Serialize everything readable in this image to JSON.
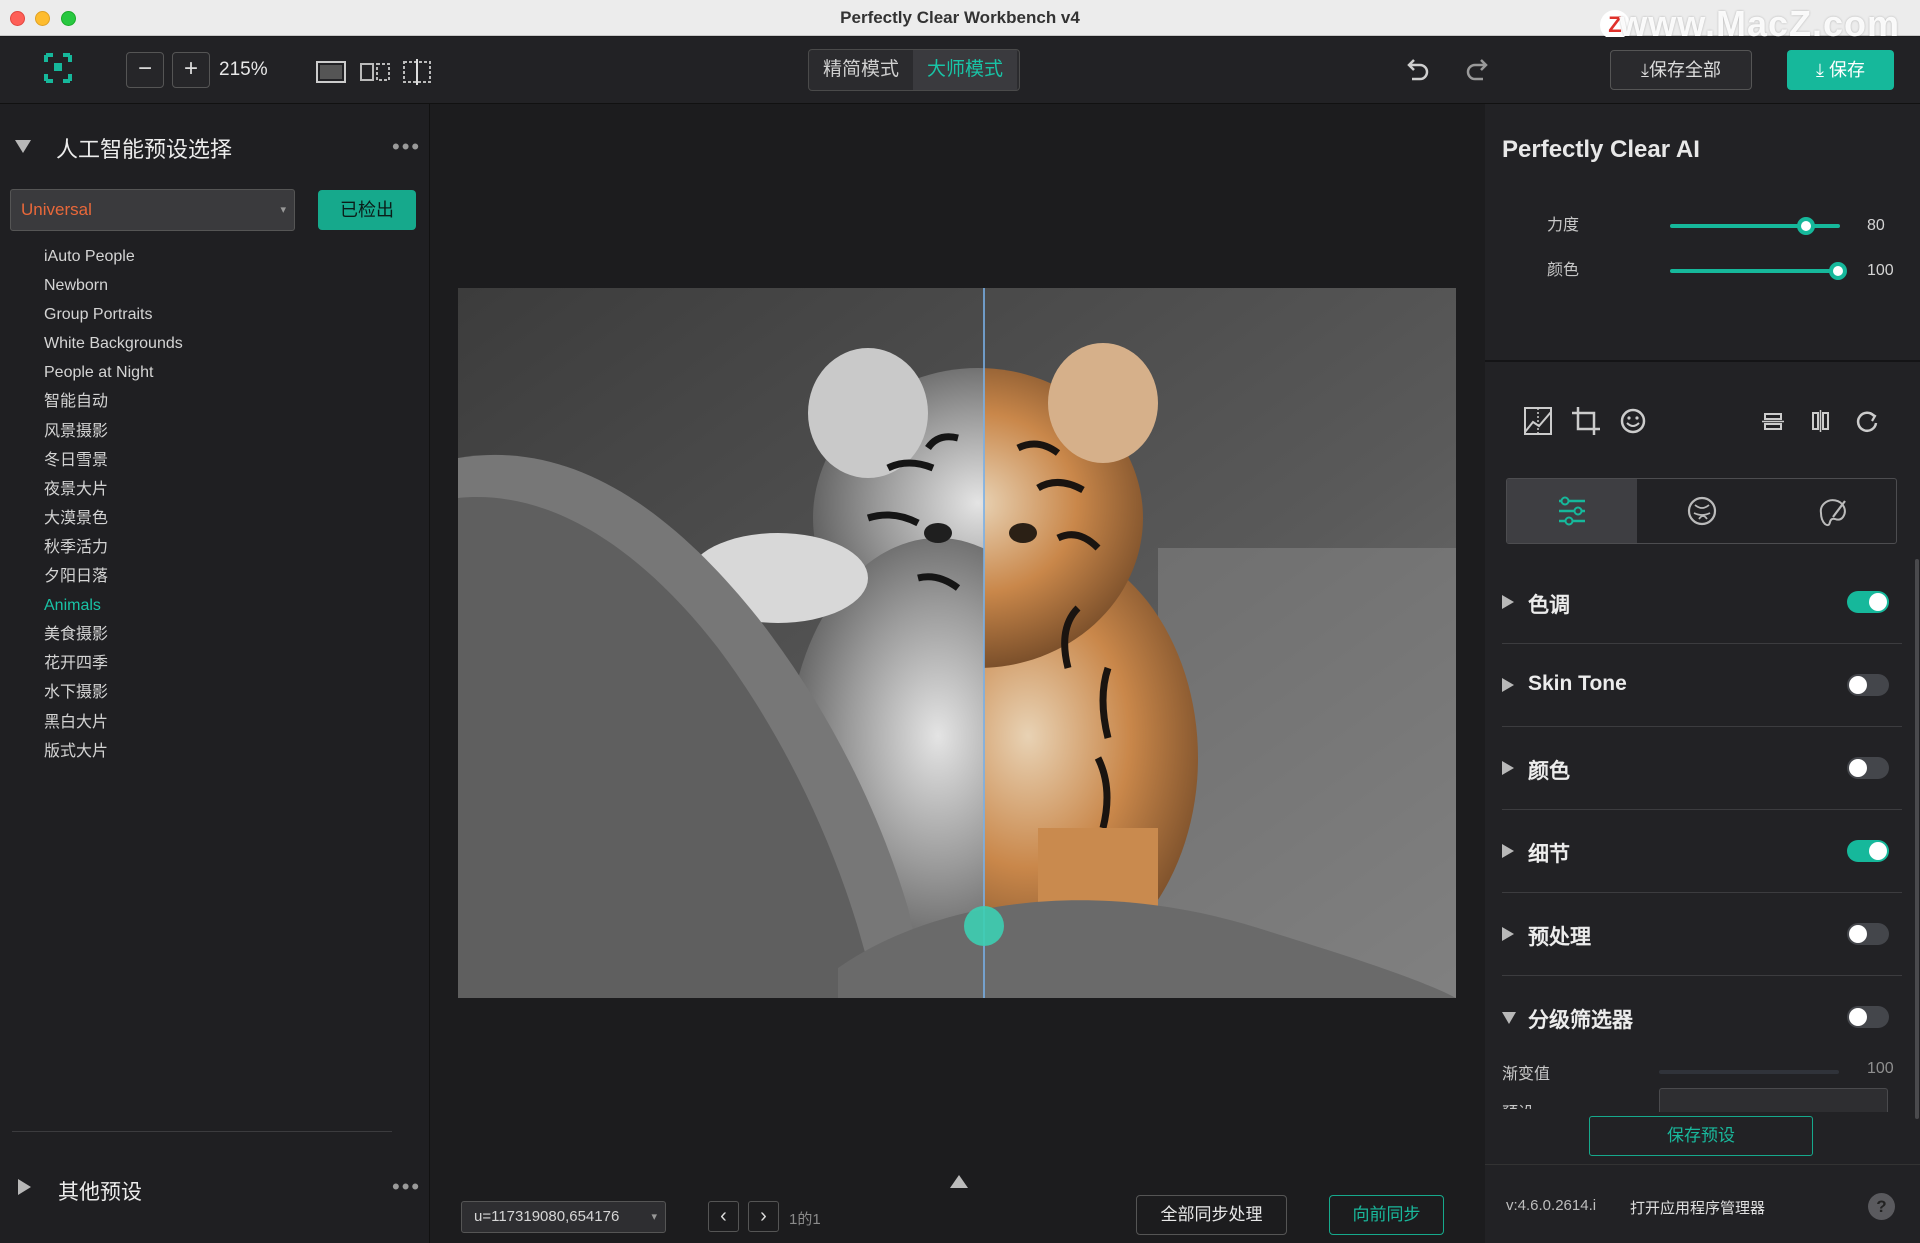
{
  "window": {
    "title": "Perfectly Clear Workbench v4",
    "watermark": "www.MacZ.com",
    "watermark_badge": "Z"
  },
  "toolbar": {
    "zoom_out": "−",
    "zoom_in": "+",
    "zoom_value": "215%",
    "mode_simple": "精简模式",
    "mode_master": "大师模式",
    "save_all": "保存全部",
    "save": "保存",
    "accent": "#16b89b"
  },
  "left_panel": {
    "title": "人工智能预设选择",
    "more": "•••",
    "preset_selected": "Universal",
    "detected_button": "已检出",
    "presets": [
      "iAuto People",
      "Newborn",
      "Group Portraits",
      "White Backgrounds",
      "People at Night",
      "智能自动",
      "风景摄影",
      "冬日雪景",
      "夜景大片",
      "大漠景色",
      "秋季活力",
      "夕阳日落",
      "Animals",
      "美食摄影",
      "花开四季",
      "水下摄影",
      "黑白大片",
      "版式大片"
    ],
    "active_preset": "Animals",
    "other_presets_title": "其他预设",
    "other_more": "•••"
  },
  "center": {
    "file_name": "u=117319080,654176",
    "prev": "‹",
    "next": "›",
    "page_count": "1的1",
    "sync_all": "全部同步处理",
    "sync_forward": "向前同步"
  },
  "right_panel": {
    "title": "Perfectly Clear AI",
    "sliders": [
      {
        "label": "力度",
        "value": "80"
      },
      {
        "label": "颜色",
        "value": "100"
      }
    ],
    "sections": [
      {
        "label": "色调",
        "on": true,
        "expanded": false
      },
      {
        "label": "Skin Tone",
        "on": false,
        "expanded": false
      },
      {
        "label": "颜色",
        "on": false,
        "expanded": false
      },
      {
        "label": "细节",
        "on": true,
        "expanded": false
      },
      {
        "label": "预处理",
        "on": false,
        "expanded": false
      },
      {
        "label": "分级筛选器",
        "on": false,
        "expanded": true
      }
    ],
    "gradient_label": "渐变值",
    "gradient_value": "100",
    "preset_label": "预设",
    "save_preset": "保存预设",
    "version": "v:4.6.0.2614.i",
    "open_manager": "打开应用程序管理器",
    "help": "?"
  }
}
